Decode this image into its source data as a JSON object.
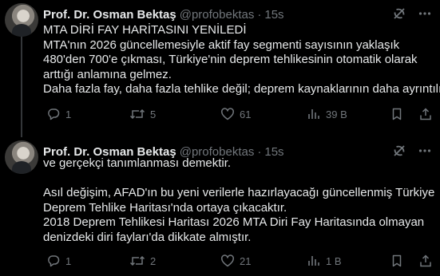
{
  "tweets": [
    {
      "author_name": "Prof. Dr. Osman Bektaş",
      "handle": "@profobektas",
      "separator": "·",
      "time": "15s",
      "lines": [
        "MTA DİRİ FAY HARİTASINI YENİLEDİ",
        "MTA'nın 2026 güncellemesiyle aktif fay segmenti sayısının yaklaşık",
        "480'den 700'e çıkması, Türkiye'nin deprem tehlikesinin otomatik olarak",
        "arttığı anlamına gelmez.",
        "Daha fazla fay, daha fazla tehlike değil; deprem kaynaklarının daha ayrıntılı"
      ],
      "reply_count": "1",
      "retweet_count": "5",
      "like_count": "61",
      "view_count": "39 B"
    },
    {
      "author_name": "Prof. Dr. Osman Bektaş",
      "handle": "@profobektas",
      "separator": "·",
      "time": "15s",
      "lines": [
        "ve gerçekçi tanımlanması demektir.",
        "",
        "Asıl değişim, AFAD'ın bu yeni verilerle hazırlayacağı güncellenmiş Türkiye",
        "Deprem Tehlike Haritası'nda ortaya çıkacaktır.",
        "2018 Deprem Tehlikesi Haritası 2026 MTA Diri Fay Haritasında olmayan",
        "denizdeki diri fayları'da dikkate almıştır."
      ],
      "reply_count": "1",
      "retweet_count": "2",
      "like_count": "21",
      "view_count": "1 B"
    }
  ],
  "icons": {
    "grok": "grok-icon",
    "more": "more-icon",
    "reply": "reply-icon",
    "retweet": "retweet-icon",
    "like": "like-icon",
    "views": "views-icon",
    "bookmark": "bookmark-icon",
    "share": "share-icon"
  },
  "colors": {
    "background": "#000000",
    "text": "#e7e9ea",
    "muted": "#71767b",
    "thread_line": "#333639"
  }
}
